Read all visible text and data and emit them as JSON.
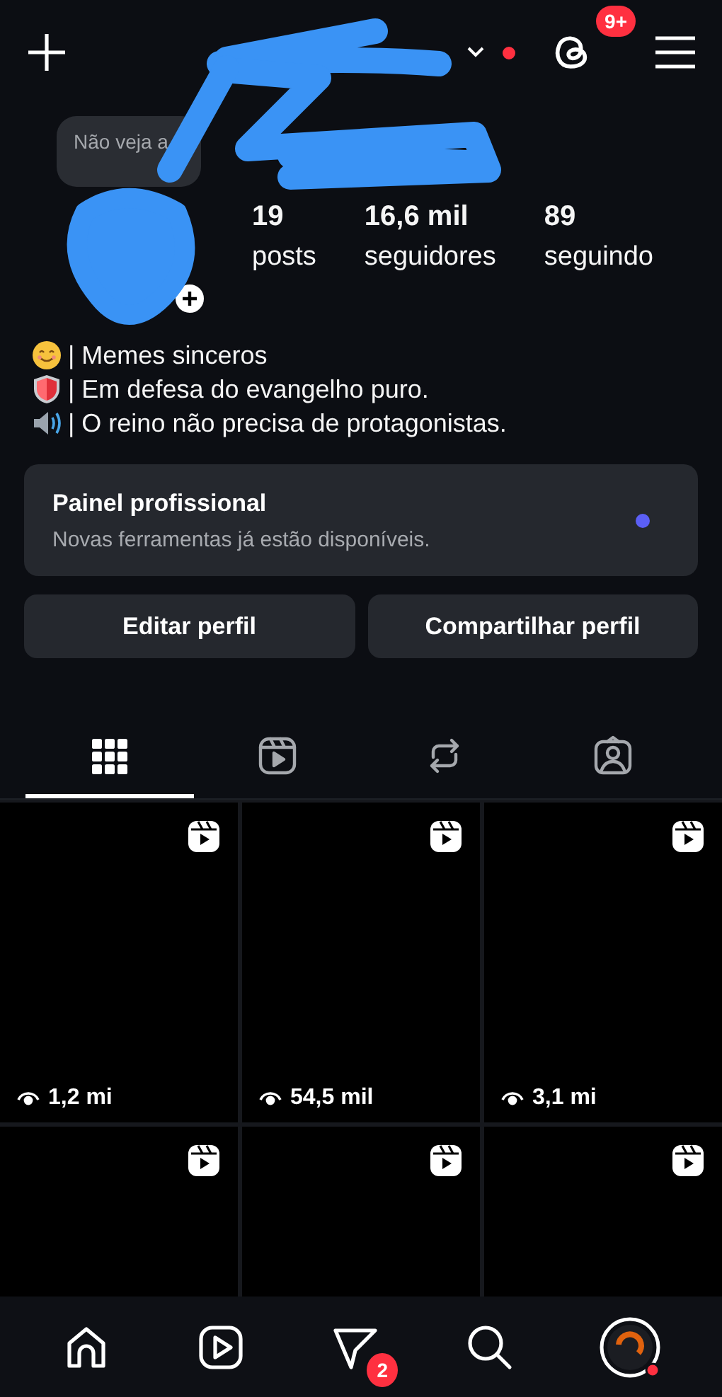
{
  "header": {
    "threads_badge": "9+",
    "has_account_alert": true
  },
  "profile": {
    "note": "Não veja a",
    "stats": [
      {
        "value": "19",
        "label": "posts"
      },
      {
        "value": "16,6 mil",
        "label": "seguidores"
      },
      {
        "value": "89",
        "label": "seguindo"
      }
    ],
    "bio": [
      {
        "kind": "smile",
        "text": "| Memes sinceros"
      },
      {
        "kind": "shield",
        "text": "| Em defesa do evangelho puro."
      },
      {
        "kind": "speaker",
        "text": "| O reino não precisa de protagonistas."
      }
    ]
  },
  "dashboard": {
    "title": "Painel profissional",
    "subtitle": "Novas ferramentas já estão disponíveis.",
    "unread": true
  },
  "buttons": [
    "Editar perfil",
    "Compartilhar perfil"
  ],
  "tabs": [
    {
      "kind": "grid",
      "selected": true
    },
    {
      "kind": "reels",
      "selected": false
    },
    {
      "kind": "reposts",
      "selected": false
    },
    {
      "kind": "tagged",
      "selected": false
    }
  ],
  "posts": [
    {
      "kind": "reel",
      "views": "1,2 mi"
    },
    {
      "kind": "reel",
      "views": "54,5 mil"
    },
    {
      "kind": "reel",
      "views": "3,1 mi"
    },
    {
      "kind": "reel"
    },
    {
      "kind": "reel"
    },
    {
      "kind": "reel"
    }
  ],
  "nav": [
    {
      "kind": "home",
      "selected": false
    },
    {
      "kind": "reels",
      "selected": false
    },
    {
      "kind": "messages",
      "selected": false,
      "badge": "2"
    },
    {
      "kind": "search",
      "selected": false
    },
    {
      "kind": "profile",
      "selected": true
    }
  ]
}
